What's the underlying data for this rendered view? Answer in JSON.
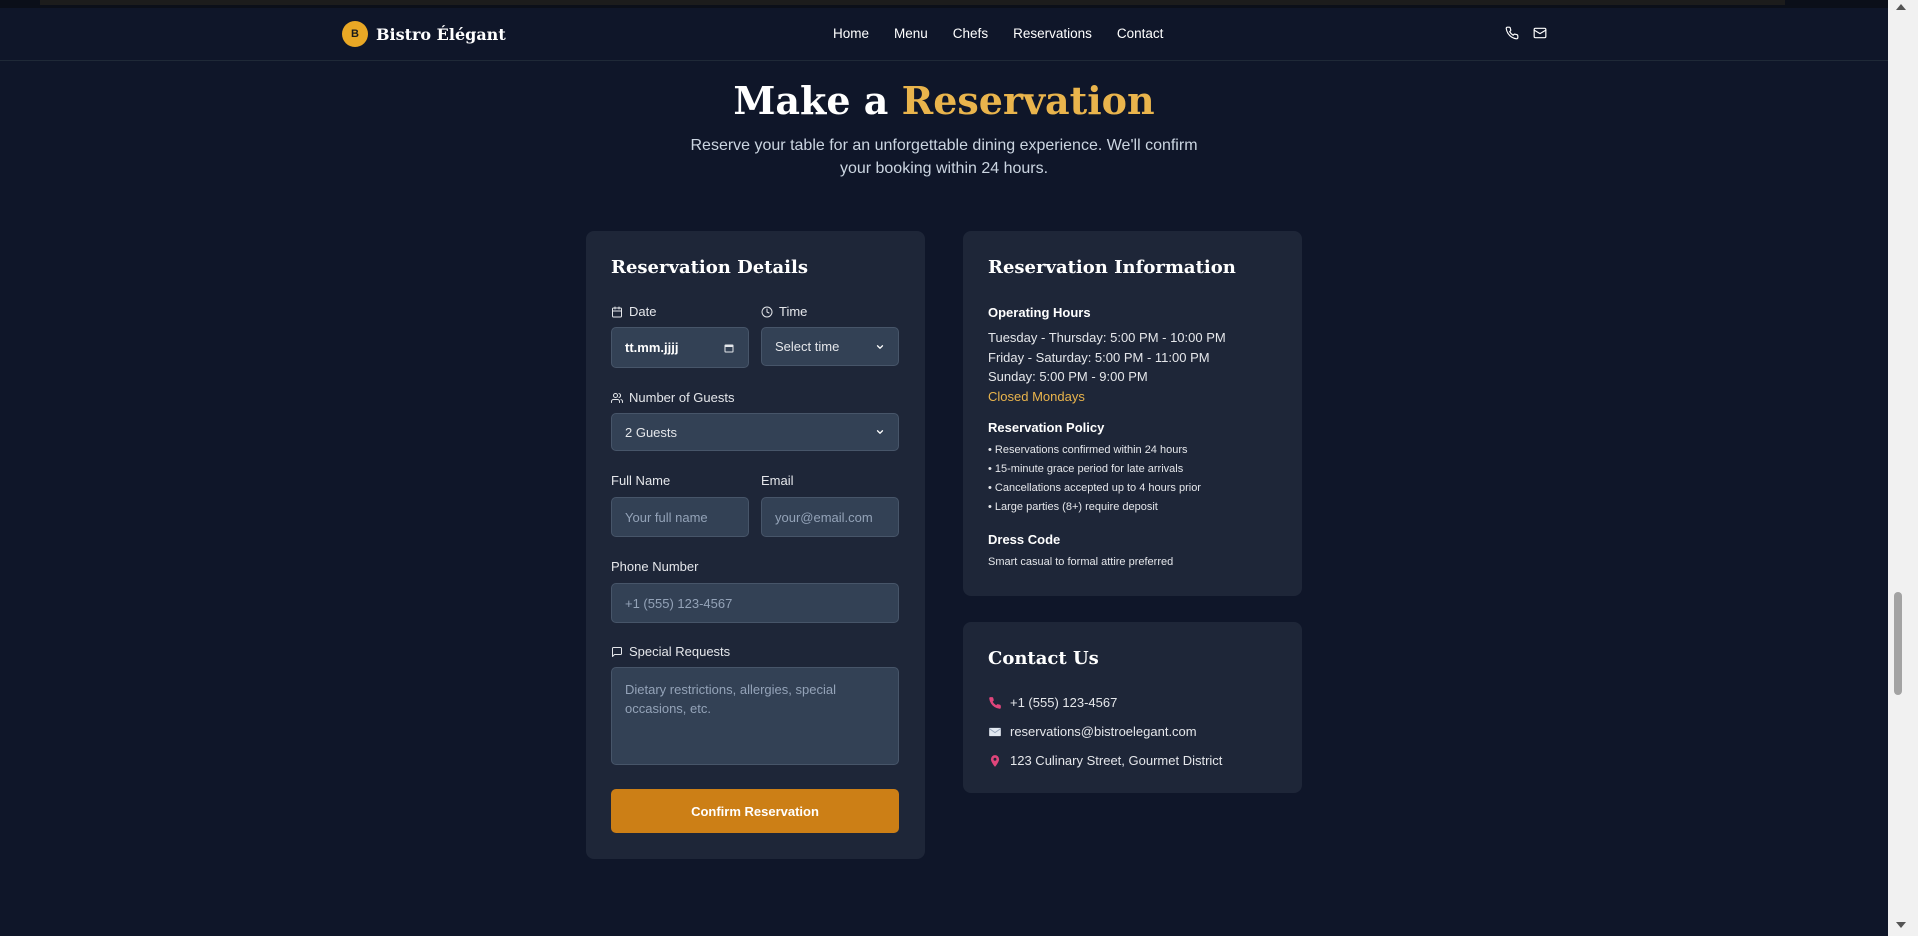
{
  "colors": {
    "background": "#0f1629",
    "card": "#1e2638",
    "accent": "#e9b44c",
    "button": "#cc7f16",
    "input": "#334155"
  },
  "navbar": {
    "logo_letter": "B",
    "brand": "Bistro Élégant",
    "links": [
      "Home",
      "Menu",
      "Chefs",
      "Reservations",
      "Contact"
    ],
    "icons": [
      "phone-icon",
      "mail-icon"
    ]
  },
  "hero": {
    "title_prefix": "Make a",
    "title_accent": "Reservation",
    "subtitle": "Reserve your table for an unforgettable dining experience. We'll confirm your booking within 24 hours."
  },
  "form": {
    "title": "Reservation Details",
    "date_label": "Date",
    "date_value": "tt.mm.jjjj",
    "time_label": "Time",
    "time_value": "Select time",
    "guests_label": "Number of Guests",
    "guests_value": "2 Guests",
    "name_label": "Full Name",
    "name_placeholder": "Your full name",
    "email_label": "Email",
    "email_placeholder": "your@email.com",
    "phone_label": "Phone Number",
    "phone_placeholder": "+1 (555) 123-4567",
    "requests_label": "Special Requests",
    "requests_placeholder": "Dietary restrictions, allergies, special occasions, etc.",
    "submit_label": "Confirm Reservation"
  },
  "info": {
    "title": "Reservation Information",
    "hours_heading": "Operating Hours",
    "hours": [
      "Tuesday - Thursday: 5:00 PM - 10:00 PM",
      "Friday - Saturday: 5:00 PM - 11:00 PM",
      "Sunday: 5:00 PM - 9:00 PM"
    ],
    "closed": "Closed Mondays",
    "policy_heading": "Reservation Policy",
    "policy": [
      "• Reservations confirmed within 24 hours",
      "• 15-minute grace period for late arrivals",
      "• Cancellations accepted up to 4 hours prior",
      "• Large parties (8+) require deposit"
    ],
    "dress_heading": "Dress Code",
    "dress_text": "Smart casual to formal attire preferred"
  },
  "contact": {
    "title": "Contact Us",
    "phone": "+1 (555) 123-4567",
    "email": "reservations@bistroelegant.com",
    "address": "123 Culinary Street, Gourmet District"
  }
}
